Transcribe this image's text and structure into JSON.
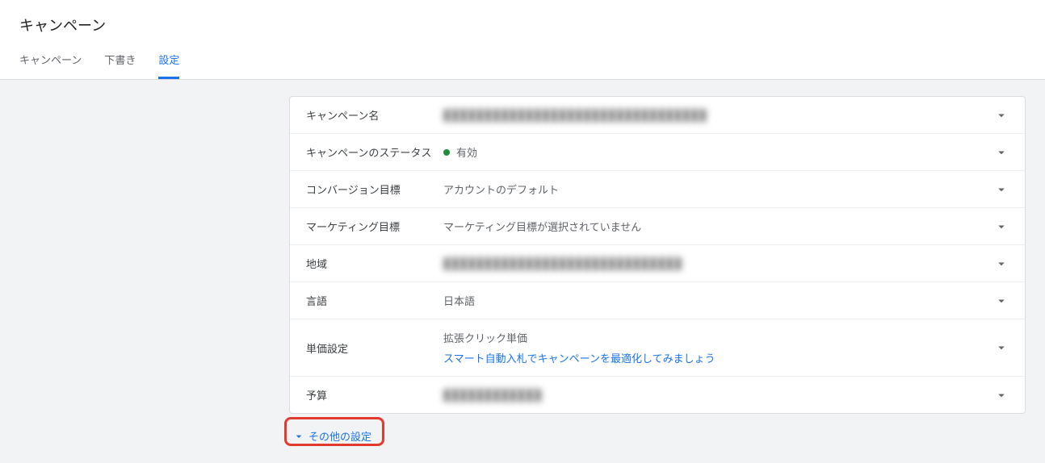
{
  "page_title": "キャンペーン",
  "tabs": {
    "campaigns": "キャンペーン",
    "drafts": "下書き",
    "settings": "設定"
  },
  "rows": {
    "campaign_name": {
      "label": "キャンペーン名",
      "value": "████████████████████████████████"
    },
    "status": {
      "label": "キャンペーンのステータス",
      "value": "有効"
    },
    "conversion_goal": {
      "label": "コンバージョン目標",
      "value": "アカウントのデフォルト"
    },
    "marketing_goal": {
      "label": "マーケティング目標",
      "value": "マーケティング目標が選択されていません"
    },
    "locations": {
      "label": "地域",
      "value": "█████████████████████████████"
    },
    "languages": {
      "label": "言語",
      "value": "日本語"
    },
    "bidding": {
      "label": "単価設定",
      "value_line1": "拡張クリック単価",
      "value_link": "スマート自動入札でキャンペーンを最適化してみましょう"
    },
    "budget": {
      "label": "予算",
      "value": "████████████"
    }
  },
  "more_settings": "その他の設定"
}
